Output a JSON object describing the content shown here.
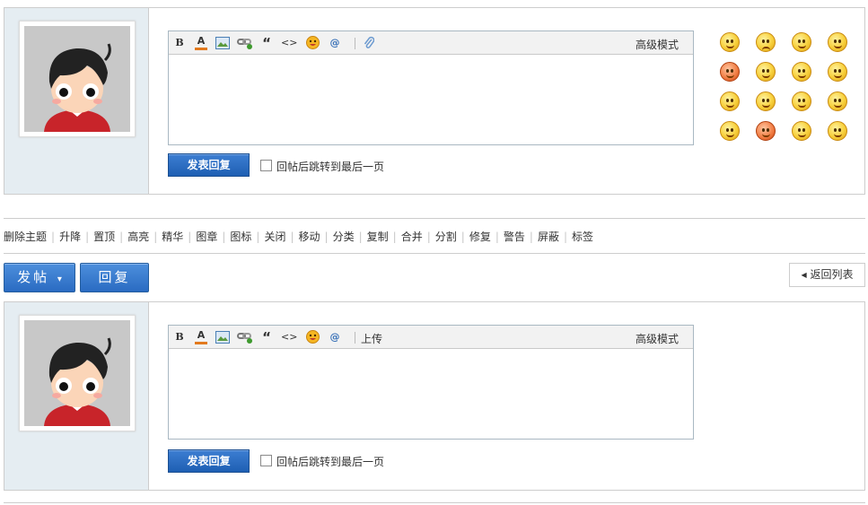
{
  "editor": {
    "bold": "B",
    "font_color": "A",
    "quote": "“",
    "code": "<>",
    "at": "@",
    "advanced_mode": "高级模式",
    "upload": "上传"
  },
  "reply_form": {
    "submit_label": "发表回复",
    "jump_last_page_label": "回帖后跳转到最后一页"
  },
  "mod_actions": [
    "删除主题",
    "升降",
    "置顶",
    "高亮",
    "精华",
    "图章",
    "图标",
    "关闭",
    "移动",
    "分类",
    "复制",
    "合并",
    "分割",
    "修复",
    "警告",
    "屏蔽",
    "标签"
  ],
  "actions": {
    "post_label": "发帖",
    "post_caret": "▾",
    "reply_label": "回复",
    "back_label": "返回列表",
    "back_icon": "◀"
  },
  "colors": {
    "accent": "#2a6bc2",
    "side_bg": "#e5edf2"
  }
}
